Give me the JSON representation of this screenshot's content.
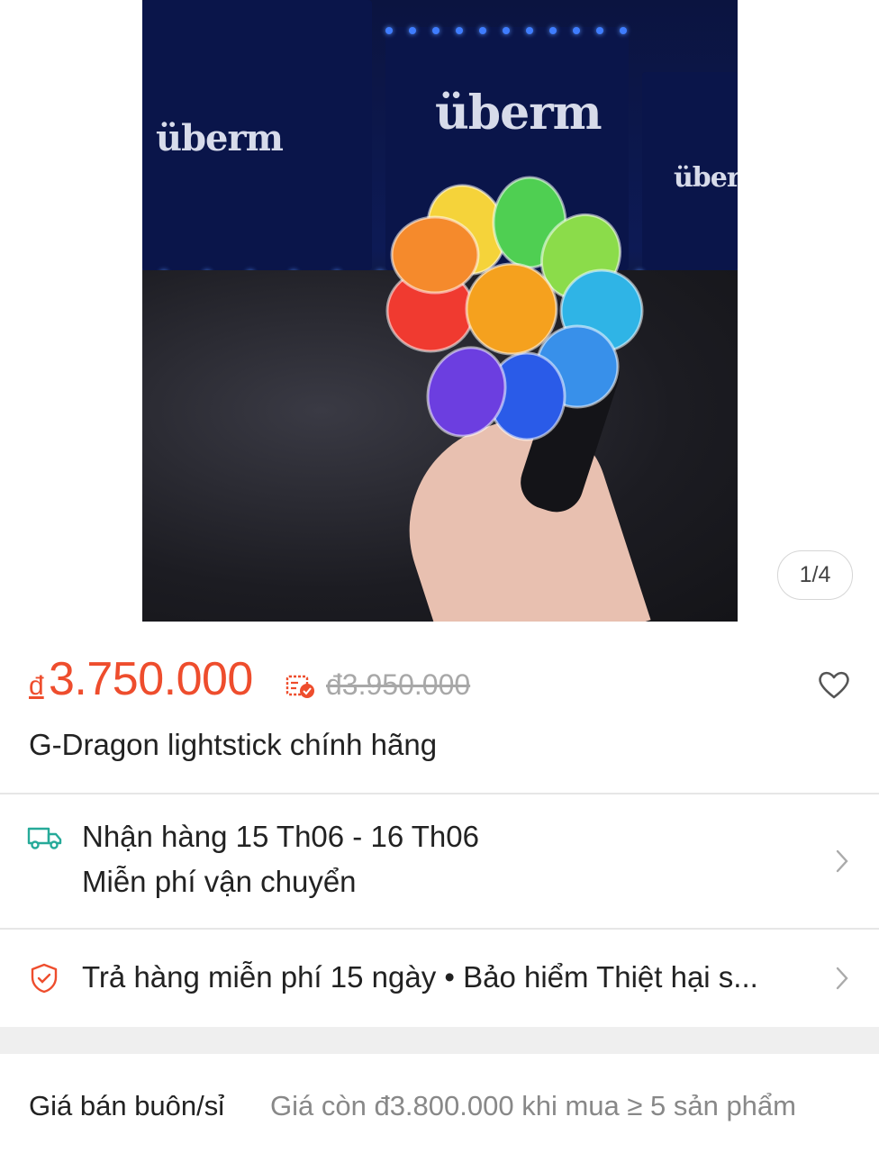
{
  "gallery": {
    "counter": "1/4",
    "photo_logo_text": "überm"
  },
  "product": {
    "currency_symbol": "đ",
    "price": "3.750.000",
    "original_price": "đ3.950.000",
    "title": "G-Dragon lightstick chính hãng"
  },
  "shipping": {
    "delivery": "Nhận hàng 15 Th06 - 16 Th06",
    "fee": "Miễn phí vận chuyển"
  },
  "returns": {
    "text": "Trả hàng miễn phí 15 ngày  •  Bảo hiểm Thiệt hại s..."
  },
  "wholesale": {
    "label": "Giá bán buôn/sỉ",
    "description": "Giá còn đ3.800.000 khi mua ≥ 5 sản phẩm"
  },
  "colors": {
    "accent": "#ee4d2d",
    "shipping_teal": "#26aa99",
    "muted": "#a8a8a8"
  },
  "icons": {
    "heart": "heart-icon",
    "truck": "truck-icon",
    "shield": "shield-icon",
    "voucher": "voucher-icon",
    "chevron": "chevron-right-icon"
  }
}
